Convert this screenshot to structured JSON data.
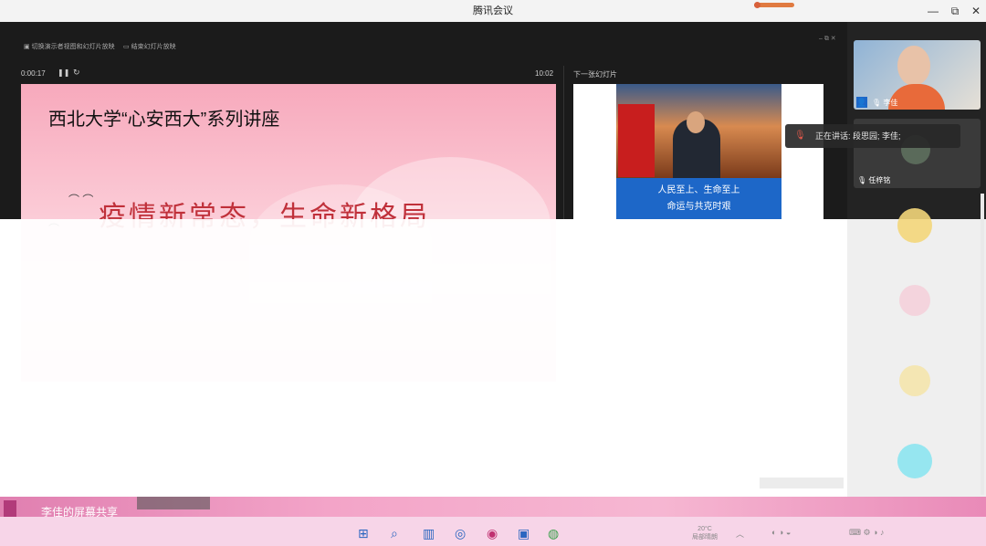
{
  "app_title": "腾讯会议",
  "window_controls": {
    "minimize": "—",
    "restore": "⧉",
    "close": "✕"
  },
  "presenter": {
    "toolbar": [
      {
        "label": "切换演示者视图和幻灯片放映",
        "icon": "screen-icon"
      },
      {
        "label": "结束幻灯片放映",
        "icon": "monitor-icon"
      }
    ],
    "timer": "0:00:17",
    "clock": "10:02",
    "next_label": "下一张幻灯片"
  },
  "slide": {
    "title": "西北大学“心安西大”系列讲座",
    "heading": "疫情新常态，生命新格局"
  },
  "next_slide": {
    "banner_line1": "人民至上、生命至上",
    "banner_line2": "命运与共克时艰"
  },
  "speaking": {
    "text": "正在讲话: 段思园; 李佳;"
  },
  "participants": [
    {
      "name": "李佳",
      "avatar": "video"
    },
    {
      "name": "任梓铭",
      "avatar": "photo"
    },
    {
      "name": "",
      "avatar": "yellow"
    },
    {
      "name": "",
      "avatar": "pink"
    },
    {
      "name": "",
      "avatar": "yellow"
    },
    {
      "name": "",
      "avatar": "cyan"
    }
  ],
  "share_label": "李佳的屏幕共享",
  "taskbar": {
    "icons": [
      "windows-icon",
      "search-icon",
      "taskview-icon",
      "edge-icon",
      "meeting-icon",
      "photos-icon",
      "chrome-icon"
    ],
    "weather_temp": "20°C",
    "weather_desc": "局部晴朗"
  },
  "colors": {
    "accent": "#1d67c8",
    "slide_pink": "#f7a9bc",
    "heading_red": "#c0303a",
    "band_pink": "#e98ab8"
  }
}
